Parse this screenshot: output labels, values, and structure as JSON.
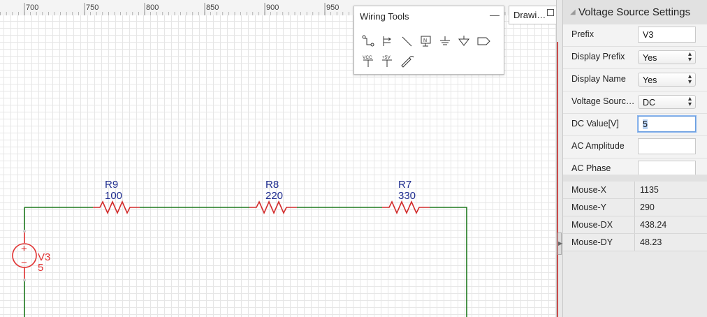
{
  "ruler": {
    "labels": [
      "700",
      "750",
      "800",
      "850",
      "900",
      "950"
    ]
  },
  "schematic": {
    "wire_color": "#1f7a1f",
    "resistor_color": "#d22b2b",
    "label_color": "#1f2d8f",
    "source_color": "#e03030",
    "resistors": [
      {
        "name": "R9",
        "value": "100"
      },
      {
        "name": "R8",
        "value": "220"
      },
      {
        "name": "R7",
        "value": "330"
      }
    ],
    "source": {
      "name": "V3",
      "value": "5",
      "plus": "+",
      "minus": "−"
    }
  },
  "wiring_tools": {
    "title": "Wiring Tools",
    "minimize": "—",
    "tools_row1": [
      "wire-icon",
      "bus-icon",
      "line-icon",
      "net-label-icon",
      "ground-icon",
      "signal-ground-icon",
      "port-icon"
    ],
    "tools_row2": [
      "vcc-icon",
      "plus5v-icon",
      "pen-icon"
    ],
    "vcc_text": "VCC",
    "plus5v_text": "+5V",
    "net_text": "N"
  },
  "drawing_tab": {
    "label": "Drawi…"
  },
  "voltage_source_settings": {
    "title": "Voltage Source Settings",
    "rows": [
      {
        "label": "Prefix",
        "kind": "input",
        "value": "V3"
      },
      {
        "label": "Display Prefix",
        "kind": "select",
        "value": "Yes"
      },
      {
        "label": "Display Name",
        "kind": "select",
        "value": "Yes"
      },
      {
        "label": "Voltage Sourc…",
        "kind": "select",
        "value": "DC"
      },
      {
        "label": "DC Value[V]",
        "kind": "input",
        "value": "5",
        "focused": true
      },
      {
        "label": "AC Amplitude",
        "kind": "input",
        "value": ""
      },
      {
        "label": "AC Phase",
        "kind": "input",
        "value": ""
      }
    ]
  },
  "mouse_info": [
    {
      "label": "Mouse-X",
      "value": "1135"
    },
    {
      "label": "Mouse-Y",
      "value": "290"
    },
    {
      "label": "Mouse-DX",
      "value": "438.24"
    },
    {
      "label": "Mouse-DY",
      "value": "48.23"
    }
  ]
}
